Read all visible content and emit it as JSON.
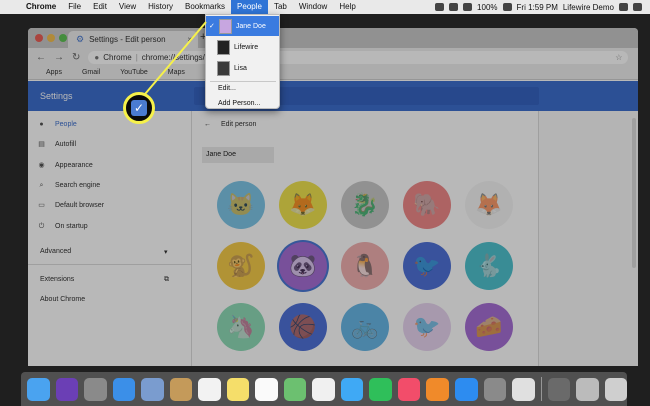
{
  "menubar": {
    "app": "Chrome",
    "items": [
      "File",
      "Edit",
      "View",
      "History",
      "Bookmarks",
      "People",
      "Tab",
      "Window",
      "Help"
    ],
    "active_item": "People",
    "battery": "100%",
    "clock": "Fri 1:59 PM",
    "user": "Lifewire Demo"
  },
  "people_menu": {
    "profiles": [
      {
        "name": "Jane Doe",
        "checked": true,
        "color": "#c7a6e0"
      },
      {
        "name": "Lifewire",
        "checked": false,
        "color": "#222222"
      },
      {
        "name": "Lisa",
        "checked": false,
        "color": "#3a3a3a"
      }
    ],
    "actions": [
      "Edit...",
      "Add Person..."
    ]
  },
  "browser": {
    "tab_title": "Settings - Edit person",
    "tab_icon": "gear-icon",
    "omnibox_origin": "Chrome",
    "omnibox_url": "chrome://settings/ma",
    "bookmarks": [
      {
        "label": "Apps",
        "color": "#e05a3a"
      },
      {
        "label": "Gmail",
        "color": "#d44638"
      },
      {
        "label": "YouTube",
        "color": "#e62117"
      },
      {
        "label": "Maps",
        "color": "#34a853"
      }
    ]
  },
  "settings": {
    "title": "Settings",
    "nav": [
      {
        "label": "People",
        "icon": "person-icon",
        "active": true
      },
      {
        "label": "Autofill",
        "icon": "clipboard-icon",
        "active": false
      },
      {
        "label": "Appearance",
        "icon": "palette-icon",
        "active": false
      },
      {
        "label": "Search engine",
        "icon": "search-icon",
        "active": false
      },
      {
        "label": "Default browser",
        "icon": "browser-icon",
        "active": false
      },
      {
        "label": "On startup",
        "icon": "power-icon",
        "active": false
      }
    ],
    "advanced": "Advanced",
    "extensions": "Extensions",
    "about": "About Chrome"
  },
  "edit_person": {
    "heading": "Edit person",
    "name_value": "Jane Doe",
    "avatars": [
      {
        "name": "cat",
        "bg": "#7fc6e8",
        "glyph": "🐱"
      },
      {
        "name": "fox",
        "bg": "#f0e34f",
        "glyph": "🦊"
      },
      {
        "name": "dragon",
        "bg": "#c9c9c9",
        "glyph": "🐉"
      },
      {
        "name": "elephant",
        "bg": "#f08a8a",
        "glyph": "🐘"
      },
      {
        "name": "origami-fox",
        "bg": "#f6f6f6",
        "glyph": "🦊"
      },
      {
        "name": "monkey",
        "bg": "#f6cc4a",
        "glyph": "🐒"
      },
      {
        "name": "panda",
        "bg": "#a770d6",
        "glyph": "🐼",
        "selected": true
      },
      {
        "name": "penguin",
        "bg": "#f1b0b0",
        "glyph": "🐧"
      },
      {
        "name": "bird",
        "bg": "#4f72d8",
        "glyph": "🐦"
      },
      {
        "name": "rabbit",
        "bg": "#4fc2cf",
        "glyph": "🐇"
      },
      {
        "name": "unicorn",
        "bg": "#8fdcb8",
        "glyph": "🦄"
      },
      {
        "name": "basketball",
        "bg": "#4f72d8",
        "glyph": "🏀"
      },
      {
        "name": "bicycle",
        "bg": "#68b7e6",
        "glyph": "🚲"
      },
      {
        "name": "cardinal",
        "bg": "#e8d5f0",
        "glyph": "🐦"
      },
      {
        "name": "cheese",
        "bg": "#a770d6",
        "glyph": "🧀"
      }
    ]
  },
  "dock": {
    "apps": [
      {
        "icon": "finder-icon",
        "color": "#4aa3f0"
      },
      {
        "icon": "siri-icon",
        "color": "#6b3fb5"
      },
      {
        "icon": "launchpad-icon",
        "color": "#8a8a8a"
      },
      {
        "icon": "safari-icon",
        "color": "#3b8fe8"
      },
      {
        "icon": "photo-icon",
        "color": "#7a9ccf"
      },
      {
        "icon": "contacts-icon",
        "color": "#c49a5a"
      },
      {
        "icon": "calendar-icon",
        "color": "#f2f2f2"
      },
      {
        "icon": "notes-icon",
        "color": "#f5de6a"
      },
      {
        "icon": "reminders-icon",
        "color": "#fafafa"
      },
      {
        "icon": "maps-icon",
        "color": "#6cc070"
      },
      {
        "icon": "photos-icon",
        "color": "#f0f0f0"
      },
      {
        "icon": "messages-icon",
        "color": "#3fa9f5"
      },
      {
        "icon": "facetime-icon",
        "color": "#2fbf5a"
      },
      {
        "icon": "music-icon",
        "color": "#f24d6a"
      },
      {
        "icon": "books-icon",
        "color": "#f08a2a"
      },
      {
        "icon": "app-store-icon",
        "color": "#2d8cf0"
      },
      {
        "icon": "system-preferences-icon",
        "color": "#8a8a8a"
      },
      {
        "icon": "chrome-icon",
        "color": "#e0e0e0"
      }
    ],
    "trailing": [
      {
        "icon": "downloads-icon",
        "color": "#6a6a6a"
      },
      {
        "icon": "window-icon",
        "color": "#bbbbbb"
      },
      {
        "icon": "trash-icon",
        "color": "#cfcfcf"
      }
    ]
  },
  "colors": {
    "accent": "#3e70cf",
    "callout": "#f6f14a",
    "menu_highlight": "#3a7be0"
  }
}
